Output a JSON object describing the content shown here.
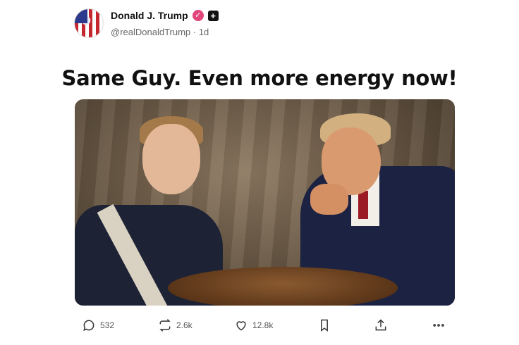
{
  "author": {
    "name": "Donald J. Trump",
    "handle": "@realDonaldTrump",
    "separator": "·",
    "time": "1d",
    "verified_icon": "verified-badge-icon",
    "follow_icon": "plus-icon",
    "accent_color": "#e0457b"
  },
  "post": {
    "text": "Same Guy. Even more energy now!"
  },
  "image": {
    "description_icon": "post-photo"
  },
  "actions": {
    "replies": "532",
    "reposts": "2.6k",
    "likes": "12.8k",
    "bookmark_icon": "bookmark-icon",
    "share_icon": "share-icon",
    "more_icon": "more-icon"
  }
}
